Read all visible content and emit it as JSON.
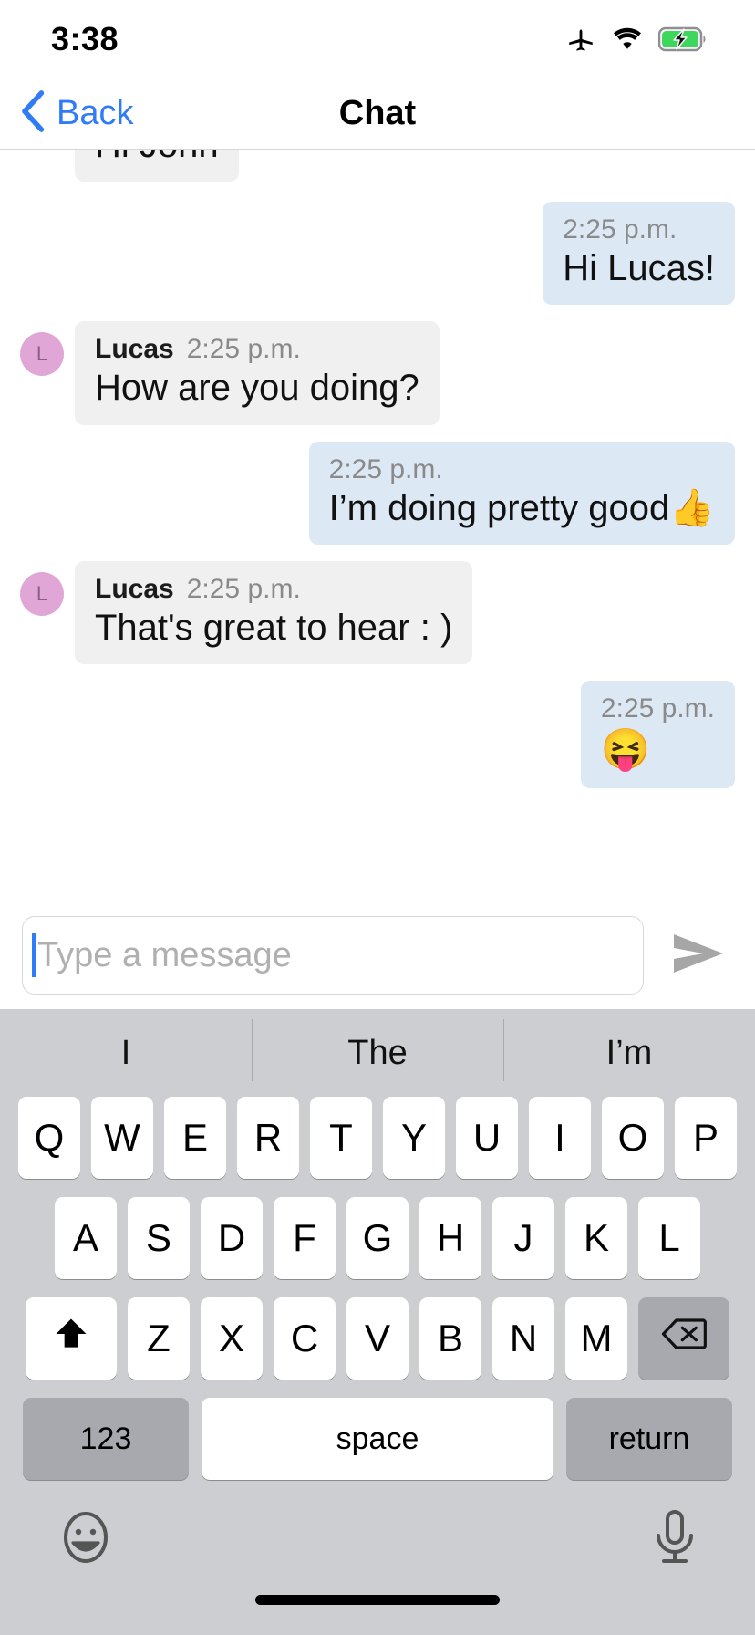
{
  "status_bar": {
    "time": "3:38",
    "icons": [
      "airplane-mode-icon",
      "wifi-icon",
      "battery-charging-icon"
    ]
  },
  "nav_bar": {
    "back_label": "Back",
    "title": "Chat",
    "back_icon": "chevron-left-icon",
    "accent_color": "#2f7cf6"
  },
  "conversation": {
    "messages": [
      {
        "direction": "incoming",
        "sender": "",
        "time": "",
        "text": "Hi John",
        "clipped": true,
        "avatar": ""
      },
      {
        "direction": "outgoing",
        "sender": "",
        "time": "2:25 p.m.",
        "text": "Hi Lucas!",
        "clipped": false,
        "avatar": ""
      },
      {
        "direction": "incoming",
        "sender": "Lucas",
        "time": "2:25 p.m.",
        "text": "How are you doing?",
        "clipped": false,
        "avatar": "L"
      },
      {
        "direction": "outgoing",
        "sender": "",
        "time": "2:25 p.m.",
        "text": "I’m doing pretty good👍",
        "clipped": false,
        "avatar": ""
      },
      {
        "direction": "incoming",
        "sender": "Lucas",
        "time": "2:25 p.m.",
        "text": "That's great to hear : )",
        "clipped": false,
        "avatar": "L"
      },
      {
        "direction": "outgoing",
        "sender": "",
        "time": "2:25 p.m.",
        "text": "😝",
        "clipped": false,
        "avatar": ""
      }
    ],
    "incoming_bubble_color": "#f0f0f0",
    "outgoing_bubble_color": "#dde8f5",
    "avatar_color": "#e0a7d6"
  },
  "composer": {
    "placeholder": "Type a message",
    "value": "",
    "send_icon": "send-arrow-icon"
  },
  "keyboard": {
    "suggestions": [
      "I",
      "The",
      "I’m"
    ],
    "row1": [
      "Q",
      "W",
      "E",
      "R",
      "T",
      "Y",
      "U",
      "I",
      "O",
      "P"
    ],
    "row2": [
      "A",
      "S",
      "D",
      "F",
      "G",
      "H",
      "J",
      "K",
      "L"
    ],
    "row3": [
      "Z",
      "X",
      "C",
      "V",
      "B",
      "N",
      "M"
    ],
    "shift_icon": "shift-up-arrow-icon",
    "backspace_icon": "backspace-delete-icon",
    "numbers_label": "123",
    "space_label": "space",
    "return_label": "return",
    "emoji_icon": "emoji-smiley-icon",
    "mic_icon": "microphone-icon",
    "background_color": "#cdced2",
    "key_color": "#ffffff",
    "special_key_color": "#a7a9af"
  }
}
